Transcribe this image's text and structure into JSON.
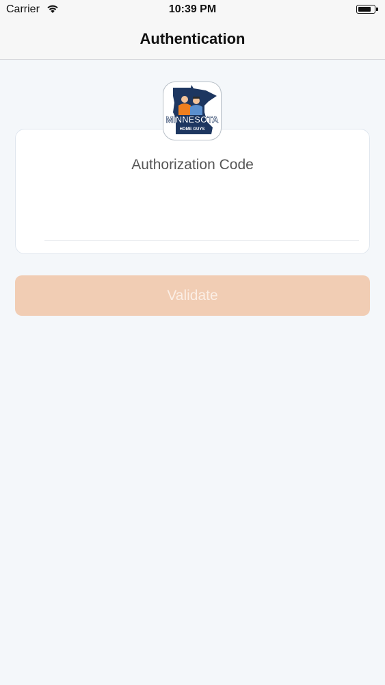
{
  "status_bar": {
    "carrier": "Carrier",
    "time": "10:39 PM",
    "battery_level": 0.85
  },
  "nav": {
    "title": "Authentication"
  },
  "logo": {
    "word": "MINNESOTA",
    "subtitle": "HOME GUYS",
    "colors": {
      "navy": "#1d3660",
      "orange": "#f07f1e",
      "blue": "#5a8fcf"
    }
  },
  "auth_card": {
    "title": "Authorization Code",
    "code_value": "",
    "code_placeholder": ""
  },
  "validate_button": {
    "label": "Validate",
    "color": "#f1cdb4"
  },
  "colors": {
    "background": "#f4f7fa",
    "nav_background": "#f7f7f7"
  }
}
